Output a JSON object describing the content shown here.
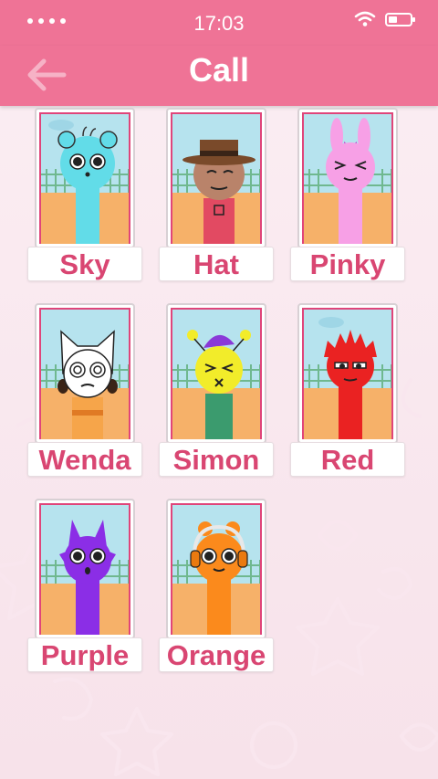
{
  "status_bar": {
    "time": "17:03",
    "battery_icon": "battery-low-icon",
    "wifi_icon": "wifi-icon"
  },
  "header": {
    "title": "Call",
    "back_icon": "arrow-left-icon"
  },
  "colors": {
    "header": "#ef7396",
    "label_text": "#d94672",
    "background": "#fbeef3"
  },
  "characters": [
    {
      "name": "Sky",
      "color": "#62dce8"
    },
    {
      "name": "Hat",
      "color": "#e24a62"
    },
    {
      "name": "Pinky",
      "color": "#f7a0e6"
    },
    {
      "name": "Wenda",
      "color": "#f6a54a"
    },
    {
      "name": "Simon",
      "color": "#f2ec2a"
    },
    {
      "name": "Red",
      "color": "#ea2222"
    },
    {
      "name": "Purple",
      "color": "#8b2ee6"
    },
    {
      "name": "Orange",
      "color": "#fb8a1c"
    }
  ]
}
